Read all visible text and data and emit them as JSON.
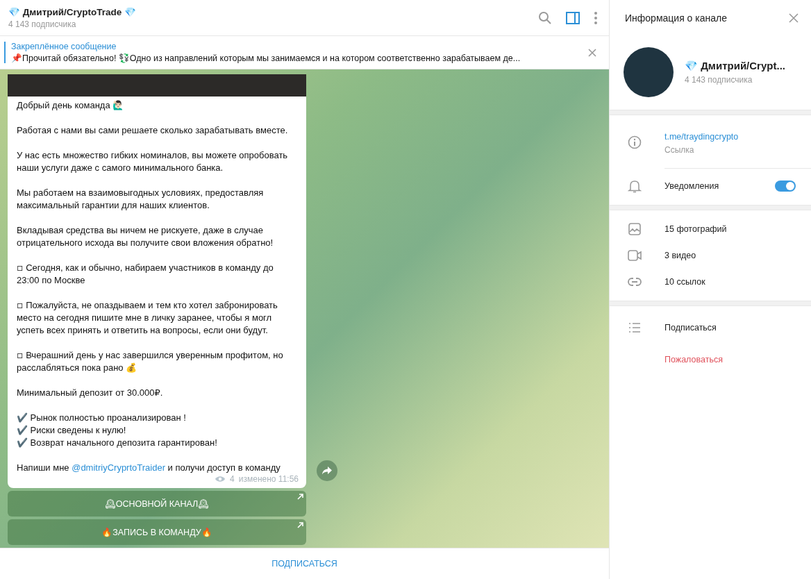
{
  "chat_header": {
    "title": "💎 Дмитрий/CryptoTrade 💎",
    "subtitle": "4 143 подписчика",
    "side_panel_on": true
  },
  "pinned": {
    "label": "Закреплённое сообщение",
    "text": "📌Прочитай обязательно!  💱Одно из направлений которым мы занимаемся и на котором соответственно зарабатываем де..."
  },
  "message": {
    "paragraphs": [
      "Добрый день команда 🙋🏻‍♂️",
      "Работая с нами вы сами решаете сколько зарабатывать вместе.",
      "У нас есть множество гибких номиналов, вы можете опробовать наши услуги даже с самого минимального банка.",
      "Мы работаем на взаимовыгодных условиях, предоставляя максимальный гарантии для наших клиентов.",
      "Вкладывая средства вы ничем не рискуете, даже в случае отрицательного исхода вы получите свои вложения обратно!",
      "◽ Сегодня, как и обычно, набираем участников в команду  до 23:00 по Москве",
      "◽ Пожалуйста, не опаздываем и тем кто хотел забронировать место на сегодня пишите мне в личку заранее, чтобы я могл успеть всех принять и ответить на вопросы, если они будут.",
      "◽ Вчерашний день у нас завершился уверенным профитом, но расслабляться пока рано 💰",
      "Минимальный депозит от 30.000₽.",
      "✔️ Рынок полностью проанализирован !\n✔️ Риски сведены к нулю!\n✔️ Возврат начального депозита гарантирован!"
    ],
    "closing": {
      "before": "Напиши мне ",
      "link": "@dmitriyCryprtoTraider",
      "after": " и получи доступ в команду"
    },
    "views": "4",
    "edited": "изменено 11:56",
    "buttons": [
      "🕰ОСНОВНОЙ КАНАЛ🕰",
      "🔥ЗАПИСЬ В КОМАНДУ🔥"
    ]
  },
  "footer_button": "ПОДПИСАТЬСЯ",
  "info_panel": {
    "title": "Информация о канале",
    "name": "💎 Дмитрий/Crypt...",
    "subscribers": "4 143 подписчика",
    "link": {
      "value": "t.me/traydingcrypto",
      "label": "Ссылка"
    },
    "notifications": {
      "label": "Уведомления",
      "on": true
    },
    "media": [
      {
        "kind": "photo",
        "label": "15 фотографий"
      },
      {
        "kind": "video",
        "label": "3 видео"
      },
      {
        "kind": "link",
        "label": "10 ссылок"
      }
    ],
    "actions": [
      {
        "kind": "subscribe",
        "label": "Подписаться"
      },
      {
        "kind": "report",
        "label": "Пожаловаться"
      }
    ]
  }
}
